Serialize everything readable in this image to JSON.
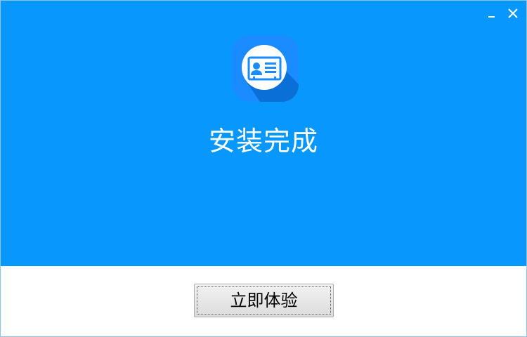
{
  "window": {
    "minimize_glyph": "minimize-icon",
    "close_glyph": "close-icon"
  },
  "app": {
    "icon": "id-card-icon",
    "status_title": "安装完成"
  },
  "footer": {
    "primary_button_label": "立即体验"
  },
  "colors": {
    "banner": "#0897fd",
    "icon_tile": "#1a8cff",
    "icon_shadow": "#0a6fd6",
    "button_text": "#000000",
    "title_text": "#ffffff"
  }
}
